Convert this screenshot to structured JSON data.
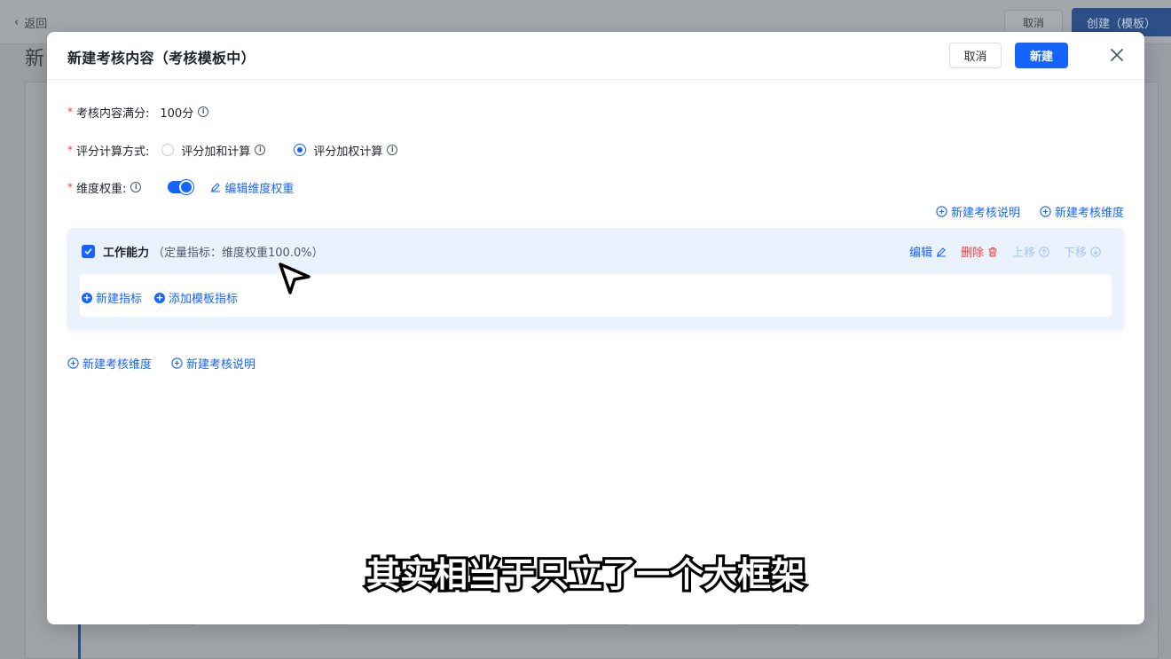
{
  "background": {
    "back_label": "返回",
    "page_title_initial": "新",
    "cancel_label": "取消",
    "create_label": "创建（模板）"
  },
  "modal": {
    "title": "新建考核内容（考核模板中）",
    "cancel_label": "取消",
    "new_label": "新建",
    "full_score": {
      "label": "考核内容满分:",
      "value": "100分"
    },
    "calc_method": {
      "label": "评分计算方式:",
      "options": [
        {
          "label": "评分加和计算",
          "selected": false
        },
        {
          "label": "评分加权计算",
          "selected": true
        }
      ]
    },
    "dim_weight": {
      "label": "维度权重:",
      "enabled": true,
      "edit_link": "编辑维度权重"
    },
    "top_links": {
      "new_note": "新建考核说明",
      "new_dimension": "新建考核维度"
    },
    "dimension": {
      "name": "工作能力",
      "meta": "（定量指标：维度权重100.0%）",
      "actions": {
        "edit": "编辑",
        "delete": "删除",
        "move_up": "上移",
        "move_down": "下移"
      },
      "new_indicator": "新建指标",
      "add_template_indicator": "添加模板指标"
    },
    "bottom_links": {
      "new_dimension": "新建考核维度",
      "new_note": "新建考核说明"
    }
  },
  "subtitle": "其实相当于只立了一个大框架",
  "colors": {
    "primary": "#1664ff",
    "danger": "#f53f3f",
    "card_bg": "#eaf2fe"
  }
}
